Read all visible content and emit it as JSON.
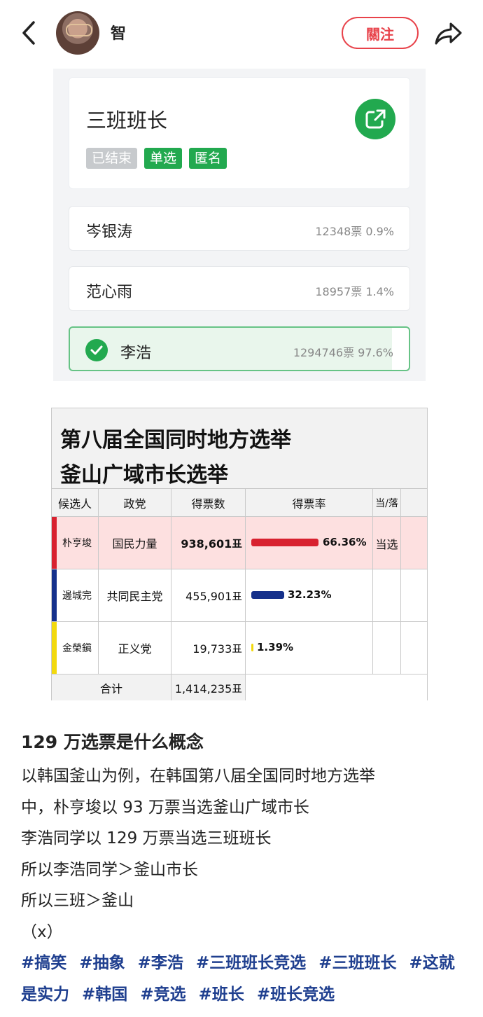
{
  "header": {
    "username": "智",
    "follow_label": "關注"
  },
  "poll": {
    "title": "三班班长",
    "tags": [
      "已结束",
      "单选",
      "匿名"
    ],
    "options": [
      {
        "name": "岑银涛",
        "stat": "12348票  0.9%"
      },
      {
        "name": "范心雨",
        "stat": "18957票  1.4%"
      },
      {
        "name": "李浩",
        "stat": "1294746票 97.6%"
      }
    ]
  },
  "election": {
    "title_line1": "第八届全国同时地方选举",
    "title_line2": "釜山广域市长选举",
    "columns": [
      "候选人",
      "政党",
      "得票数",
      "得票率",
      "当/落"
    ],
    "rows": [
      {
        "candidate": "朴亨埈",
        "party": "国民力量",
        "votes": "938,601표",
        "rate": "66.36%",
        "result": "当选",
        "color": "#d8212f"
      },
      {
        "candidate": "邊城完",
        "party": "共同民主党",
        "votes": "455,901표",
        "rate": "32.23%",
        "result": "",
        "color": "#15308b"
      },
      {
        "candidate": "金榮鎭",
        "party": "正义党",
        "votes": "19,733표",
        "rate": "1.39%",
        "result": "",
        "color": "#f2d90d"
      }
    ],
    "total_label": "合计",
    "total_votes": "1,414,235표"
  },
  "post": {
    "title": "129 万选票是什么概念",
    "lines": [
      "以韩国釜山为例，在韩国第八届全国同时地方选举",
      "中，朴亨埈以 93 万票当选釜山广域市长",
      "李浩同学以 129 万票当选三班班长",
      "所以李浩同学＞釜山市长",
      "所以三班＞釜山",
      "（x）"
    ],
    "hashtags": [
      "#搞笑",
      "#抽象",
      "#李浩",
      "#三班班长竞选",
      "#三班班长",
      "#这就是实力",
      "#韩国",
      "#竞选",
      "#班长",
      "#班长竞选"
    ]
  }
}
